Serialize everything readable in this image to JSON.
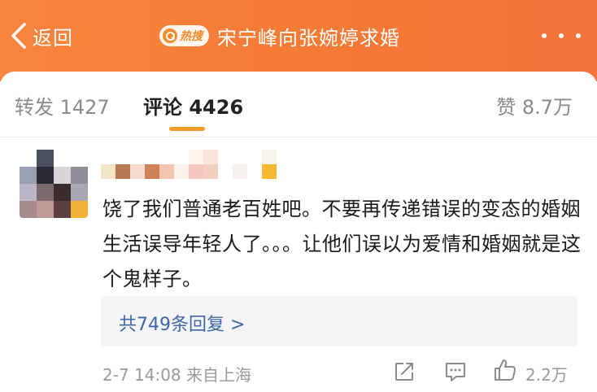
{
  "header": {
    "back_label": "返回",
    "hot_badge": "热搜",
    "title": "宋宁峰向张婉婷求婚"
  },
  "tabs": {
    "forward": "转发 1427",
    "comments": "评论 4426",
    "likes": "赞 8.7万"
  },
  "comment": {
    "text": "饶了我们普通老百姓吧。不要再传递错误的变态的婚姻生活误导年轻人了。。。让他们误以为爱情和婚姻就是这个鬼样子。",
    "replies_link": "共749条回复 >",
    "meta": "2-7 14:08 来自上海",
    "like_count": "2.2万"
  },
  "colors": {
    "header_bg": "#f57a35",
    "link_blue": "#3e66a8",
    "tab_indicator": "#f39a2b",
    "avatar_pixels": [
      "#ffffff",
      "#4a5060",
      "#ffffff",
      "#ffffff",
      "#9aa0b4",
      "#2a2a36",
      "#d8d4d8",
      "#8e8e96",
      "#b8b6c6",
      "#7a6a6e",
      "#3a2c2c",
      "#a8a8b0",
      "#a48c8c",
      "#bf9a96",
      "#5a4040",
      "#f2b23a"
    ],
    "username_pixels_top": [
      "#ffffff",
      "#ffffff",
      "#ffffff",
      "#ffffff",
      "#ffffff",
      "#ffffff",
      "#fff4ee",
      "#fbe6dc",
      "#ffffff",
      "#ffffff",
      "#ffffff",
      "#f9f3ee"
    ],
    "username_pixels_bottom": [
      "#f2e6c6",
      "#b87a52",
      "#f6dcd0",
      "#d08256",
      "#f2c6ae",
      "#fbf2ee",
      "#f4c8c0",
      "#f2cfbe",
      "#ffffff",
      "#f6f1ee",
      "#ffffff",
      "#f6b830"
    ]
  }
}
